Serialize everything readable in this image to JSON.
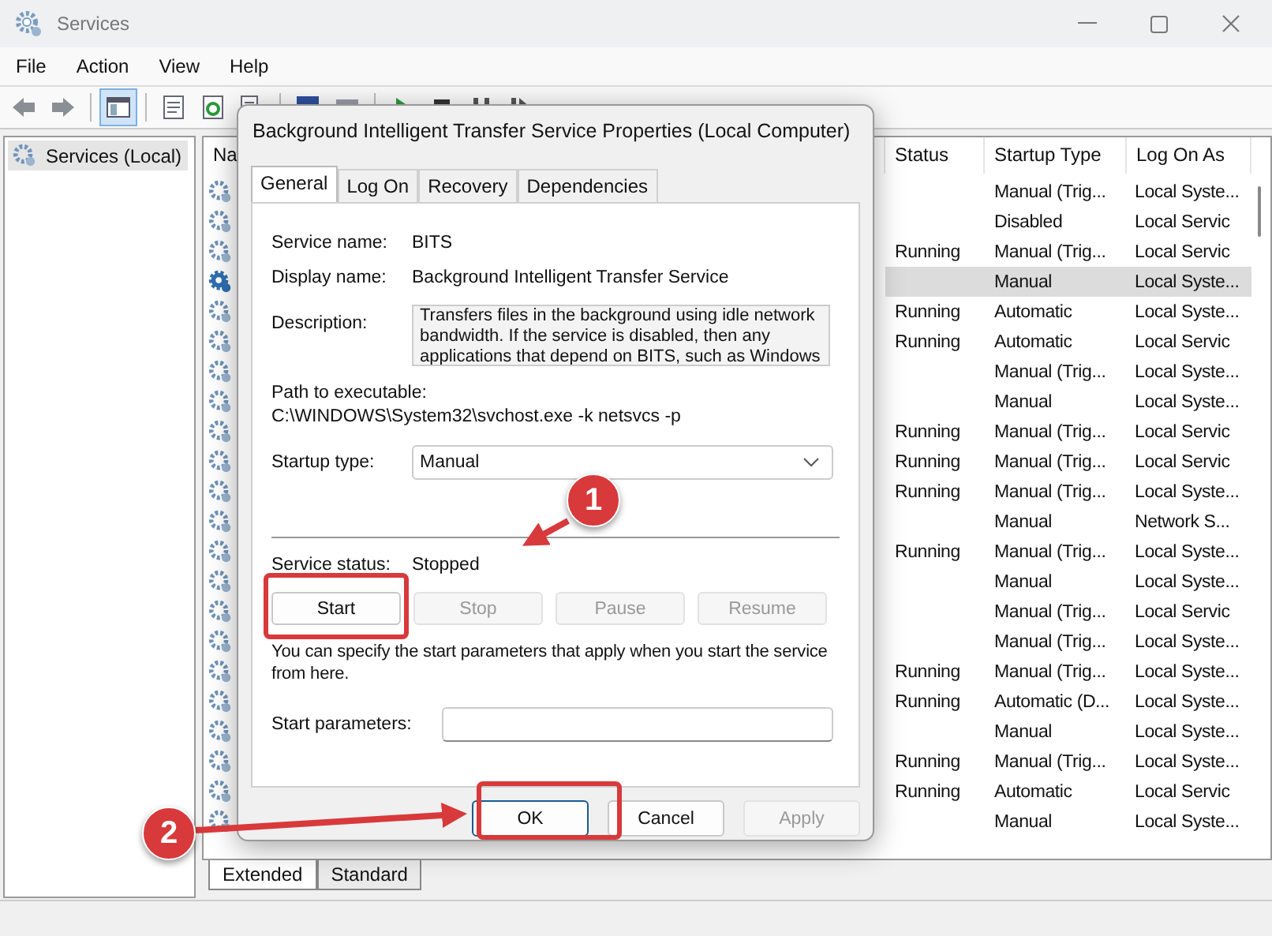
{
  "window": {
    "title": "Services"
  },
  "menu": [
    "File",
    "Action",
    "View",
    "Help"
  ],
  "tree": [
    {
      "label": "Services (Local)",
      "selected": true
    }
  ],
  "list": {
    "columns": [
      "Na",
      "Status",
      "Startup Type",
      "Log On As"
    ],
    "rows": [
      {
        "startup": "Manual (Trig...",
        "logon": "Local Syste...",
        "selected": false
      },
      {
        "startup": "Disabled",
        "logon": "Local Servic",
        "selected": false
      },
      {
        "status": "Running",
        "startup": "Manual (Trig...",
        "logon": "Local Servic",
        "selected": false
      },
      {
        "startup": "Manual",
        "logon": "Local Syste...",
        "selected": true
      },
      {
        "status": "Running",
        "startup": "Automatic",
        "logon": "Local Syste...",
        "selected": false
      },
      {
        "status": "Running",
        "startup": "Automatic",
        "logon": "Local Servic",
        "selected": false
      },
      {
        "startup": "Manual (Trig...",
        "logon": "Local Syste...",
        "selected": false
      },
      {
        "startup": "Manual",
        "logon": "Local Syste...",
        "selected": false
      },
      {
        "status": "Running",
        "startup": "Manual (Trig...",
        "logon": "Local Servic",
        "selected": false
      },
      {
        "status": "Running",
        "startup": "Manual (Trig...",
        "logon": "Local Servic",
        "selected": false
      },
      {
        "status": "Running",
        "startup": "Manual (Trig...",
        "logon": "Local Syste...",
        "selected": false
      },
      {
        "startup": "Manual",
        "logon": "Network S...",
        "selected": false
      },
      {
        "status": "Running",
        "startup": "Manual (Trig...",
        "logon": "Local Syste...",
        "selected": false
      },
      {
        "startup": "Manual",
        "logon": "Local Syste...",
        "selected": false
      },
      {
        "startup": "Manual (Trig...",
        "logon": "Local Servic",
        "selected": false
      },
      {
        "startup": "Manual (Trig...",
        "logon": "Local Syste...",
        "selected": false
      },
      {
        "status": "Running",
        "startup": "Manual (Trig...",
        "logon": "Local Syste...",
        "selected": false
      },
      {
        "status": "Running",
        "startup": "Automatic (D...",
        "logon": "Local Syste...",
        "selected": false
      },
      {
        "startup": "Manual",
        "logon": "Local Syste...",
        "selected": false
      },
      {
        "status": "Running",
        "startup": "Manual (Trig...",
        "logon": "Local Syste...",
        "selected": false
      },
      {
        "status": "Running",
        "startup": "Automatic",
        "logon": "Local Servic",
        "selected": false
      },
      {
        "startup": "Manual",
        "logon": "Local Syste...",
        "selected": false
      }
    ]
  },
  "view_tabs": [
    {
      "label": "Extended",
      "selected": true
    },
    {
      "label": "Standard",
      "selected": false
    }
  ],
  "dialog": {
    "title": "Background Intelligent Transfer Service Properties (Local Computer)",
    "tabs": [
      {
        "label": "General",
        "selected": true
      },
      {
        "label": "Log On",
        "selected": false
      },
      {
        "label": "Recovery",
        "selected": false
      },
      {
        "label": "Dependencies",
        "selected": false
      }
    ],
    "service_name": {
      "label": "Service name:",
      "value": "BITS"
    },
    "display_name": {
      "label": "Display name:",
      "value": "Background Intelligent Transfer Service"
    },
    "description": {
      "label": "Description:",
      "value": "Transfers files in the background using idle network bandwidth. If the service is disabled, then any applications that depend on BITS, such as Windows"
    },
    "path": {
      "label": "Path to executable:",
      "value": "C:\\WINDOWS\\System32\\svchost.exe -k netsvcs -p"
    },
    "startup_type": {
      "label": "Startup type:",
      "value": "Manual"
    },
    "service_status": {
      "label": "Service status:",
      "value": "Stopped"
    },
    "control_buttons": [
      {
        "label": "Start",
        "disabled": false
      },
      {
        "label": "Stop",
        "disabled": true
      },
      {
        "label": "Pause",
        "disabled": true
      },
      {
        "label": "Resume",
        "disabled": true
      }
    ],
    "hint": "You can specify the start parameters that apply when you start the service from here.",
    "start_parameters": {
      "label": "Start parameters:"
    },
    "buttons": [
      {
        "label": "OK",
        "disabled": false,
        "default": true
      },
      {
        "label": "Cancel",
        "disabled": false,
        "default": false
      },
      {
        "label": "Apply",
        "disabled": true,
        "default": false
      }
    ]
  },
  "annotations": [
    {
      "label": "1"
    },
    {
      "label": "2"
    }
  ]
}
